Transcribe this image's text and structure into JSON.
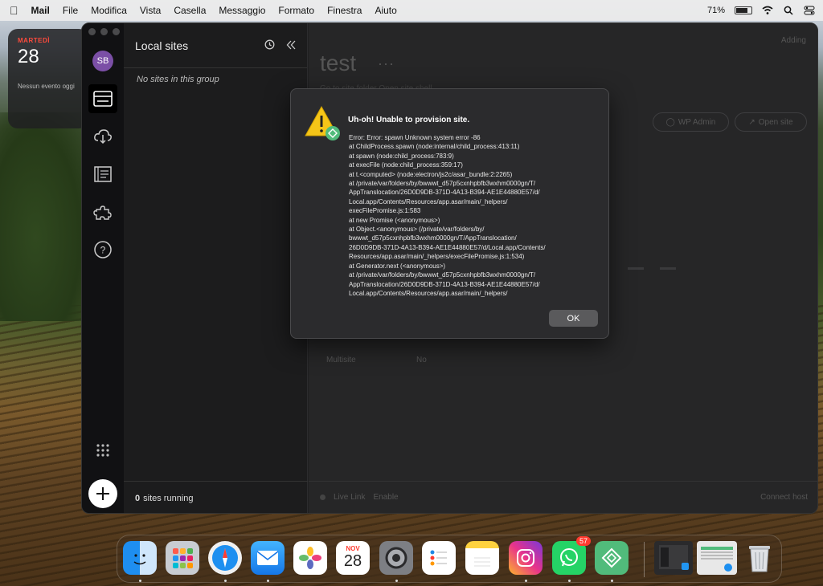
{
  "menubar": {
    "items": [
      "Mail",
      "File",
      "Modifica",
      "Vista",
      "Casella",
      "Messaggio",
      "Formato",
      "Finestra",
      "Aiuto"
    ],
    "battery": "71%"
  },
  "widget": {
    "weekday": "MARTEDÌ",
    "day": "28",
    "events": "Nessun evento oggi"
  },
  "sidebar": {
    "avatar": "SB",
    "title": "Local sites",
    "empty_text": "No sites in this group",
    "running_count": "0",
    "running_label": "sites running"
  },
  "main": {
    "site_name": "test",
    "more": "···",
    "status": "Adding",
    "sublinks": "Go to site folder    Open site shell",
    "wp_admin": "WP Admin",
    "open_site": "Open site",
    "multisite_label": "Multisite",
    "multisite_value": "No",
    "live_link": "Live Link",
    "enable": "Enable",
    "connect_host": "Connect host"
  },
  "dialog": {
    "title": "Uh-oh! Unable to provision site.",
    "lines": [
      "Error: Error: spawn Unknown system error -86",
      "at ChildProcess.spawn (node:internal/child_process:413:11)",
      "at spawn (node:child_process:783:9)",
      "at execFile (node:child_process:359:17)",
      "at t.<computed> (node:electron/js2c/asar_bundle:2:2265)",
      "at /private/var/folders/by/bwwwt_d57p5cxnhpbfb3wxhm0000gn/T/",
      "AppTranslocation/26D0D9DB-371D-4A13-B394-AE1E44880E57/d/",
      "Local.app/Contents/Resources/app.asar/main/_helpers/",
      "execFilePromise.js:1:583",
      "at new Promise (<anonymous>)",
      "at Object.<anonymous> (/private/var/folders/by/",
      "bwwwt_d57p5cxnhpbfb3wxhm0000gn/T/AppTranslocation/",
      "26D0D9DB-371D-4A13-B394-AE1E44880E57/d/Local.app/Contents/",
      "Resources/app.asar/main/_helpers/execFilePromise.js:1:534)",
      "at Generator.next (<anonymous>)",
      "at /private/var/folders/by/bwwwt_d57p5cxnhpbfb3wxhm0000gn/T/",
      "AppTranslocation/26D0D9DB-371D-4A13-B394-AE1E44880E57/d/",
      "Local.app/Contents/Resources/app.asar/main/_helpers/"
    ],
    "ok": "OK"
  },
  "dock": {
    "calendar_month": "NOV",
    "calendar_day": "28",
    "whatsapp_badge": "57"
  }
}
